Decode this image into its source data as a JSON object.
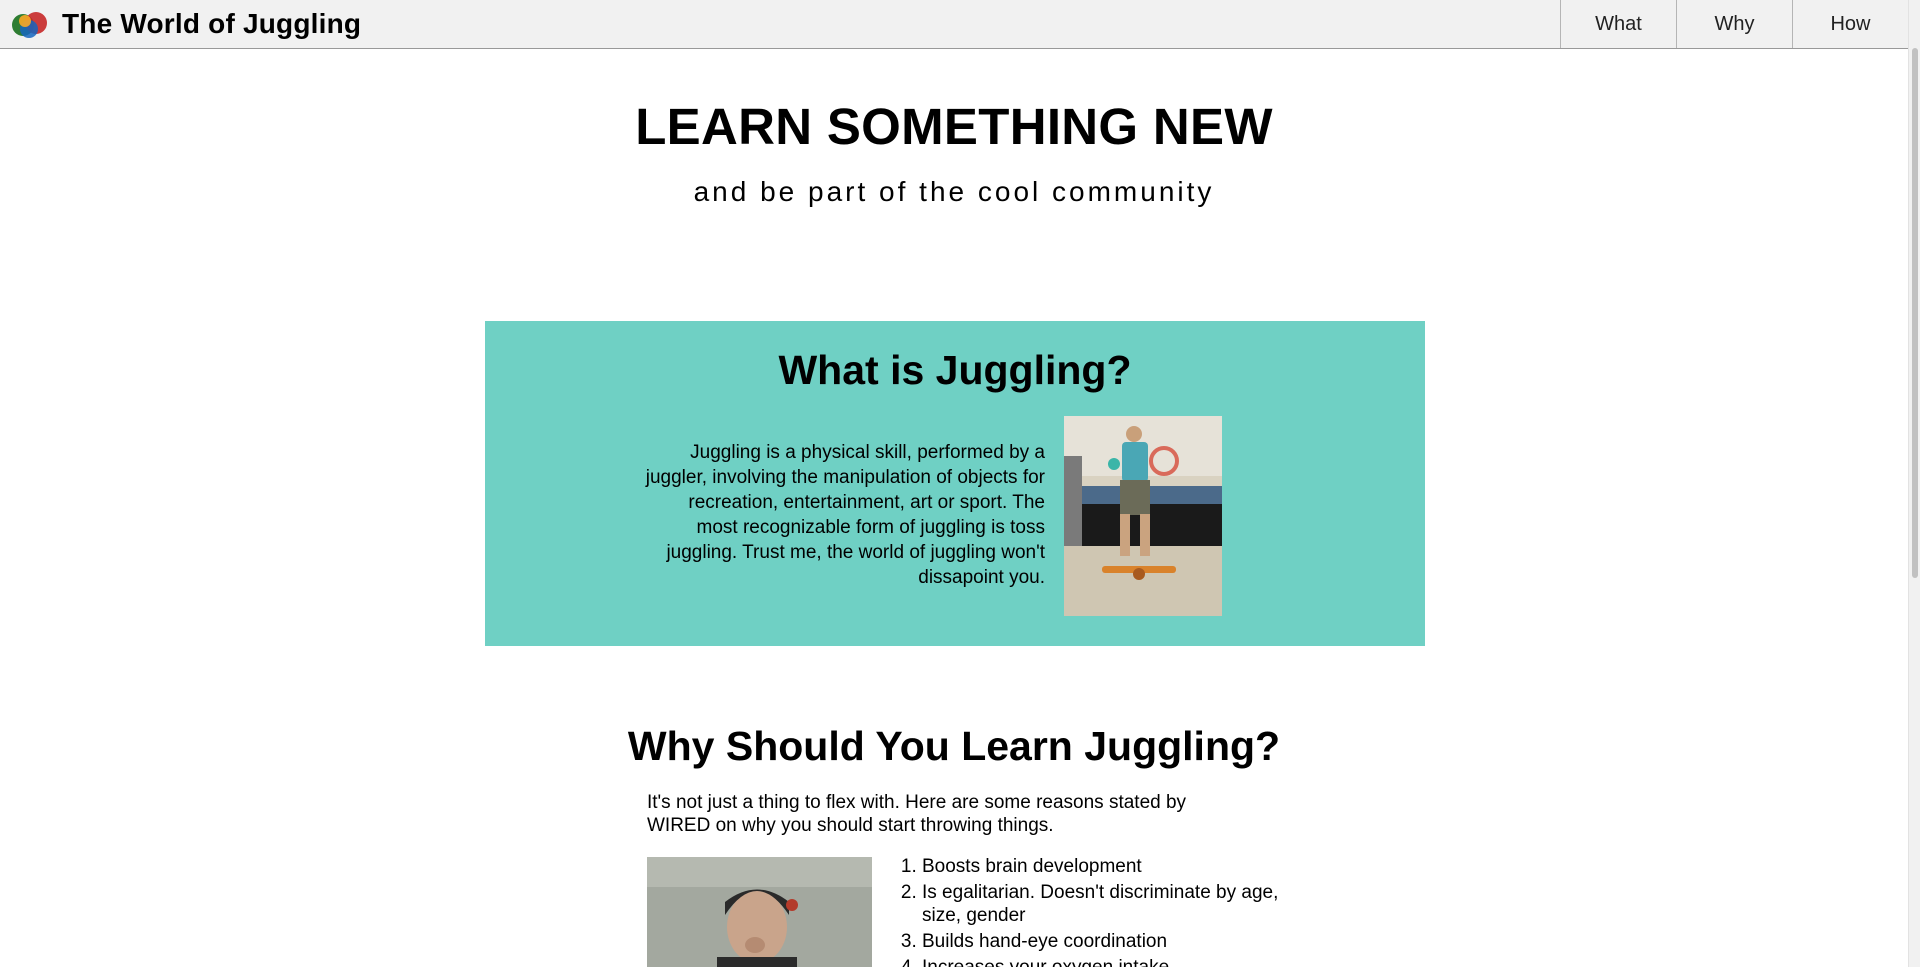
{
  "header": {
    "brand_title": "The World of Juggling",
    "logo_icon": "juggling-balls-logo-icon",
    "nav": [
      {
        "label": "What"
      },
      {
        "label": "Why"
      },
      {
        "label": "How"
      }
    ]
  },
  "hero": {
    "title": "LEARN SOMETHING NEW",
    "subtitle": "and be part of the cool community"
  },
  "what": {
    "title": "What is Juggling?",
    "text": "Juggling is a physical skill, performed by a juggler, involving the manipulation of objects for recreation, entertainment, art or sport. The most recognizable form of juggling is toss juggling. Trust me, the world of juggling won't dissapoint you.",
    "image": "juggler-on-balance-board-photo",
    "background_color": "#6fd0c4"
  },
  "why": {
    "title": "Why Should You Learn Juggling?",
    "intro": "It's not just a thing to flex with. Here are some reasons stated by WIRED on why you should start throwing things.",
    "image": "person-juggling-video-still",
    "reasons": [
      "Boosts brain development",
      "Is egalitarian. Doesn't discriminate by age, size, gender",
      "Builds hand-eye coordination",
      "Increases your oxygen intake"
    ]
  }
}
